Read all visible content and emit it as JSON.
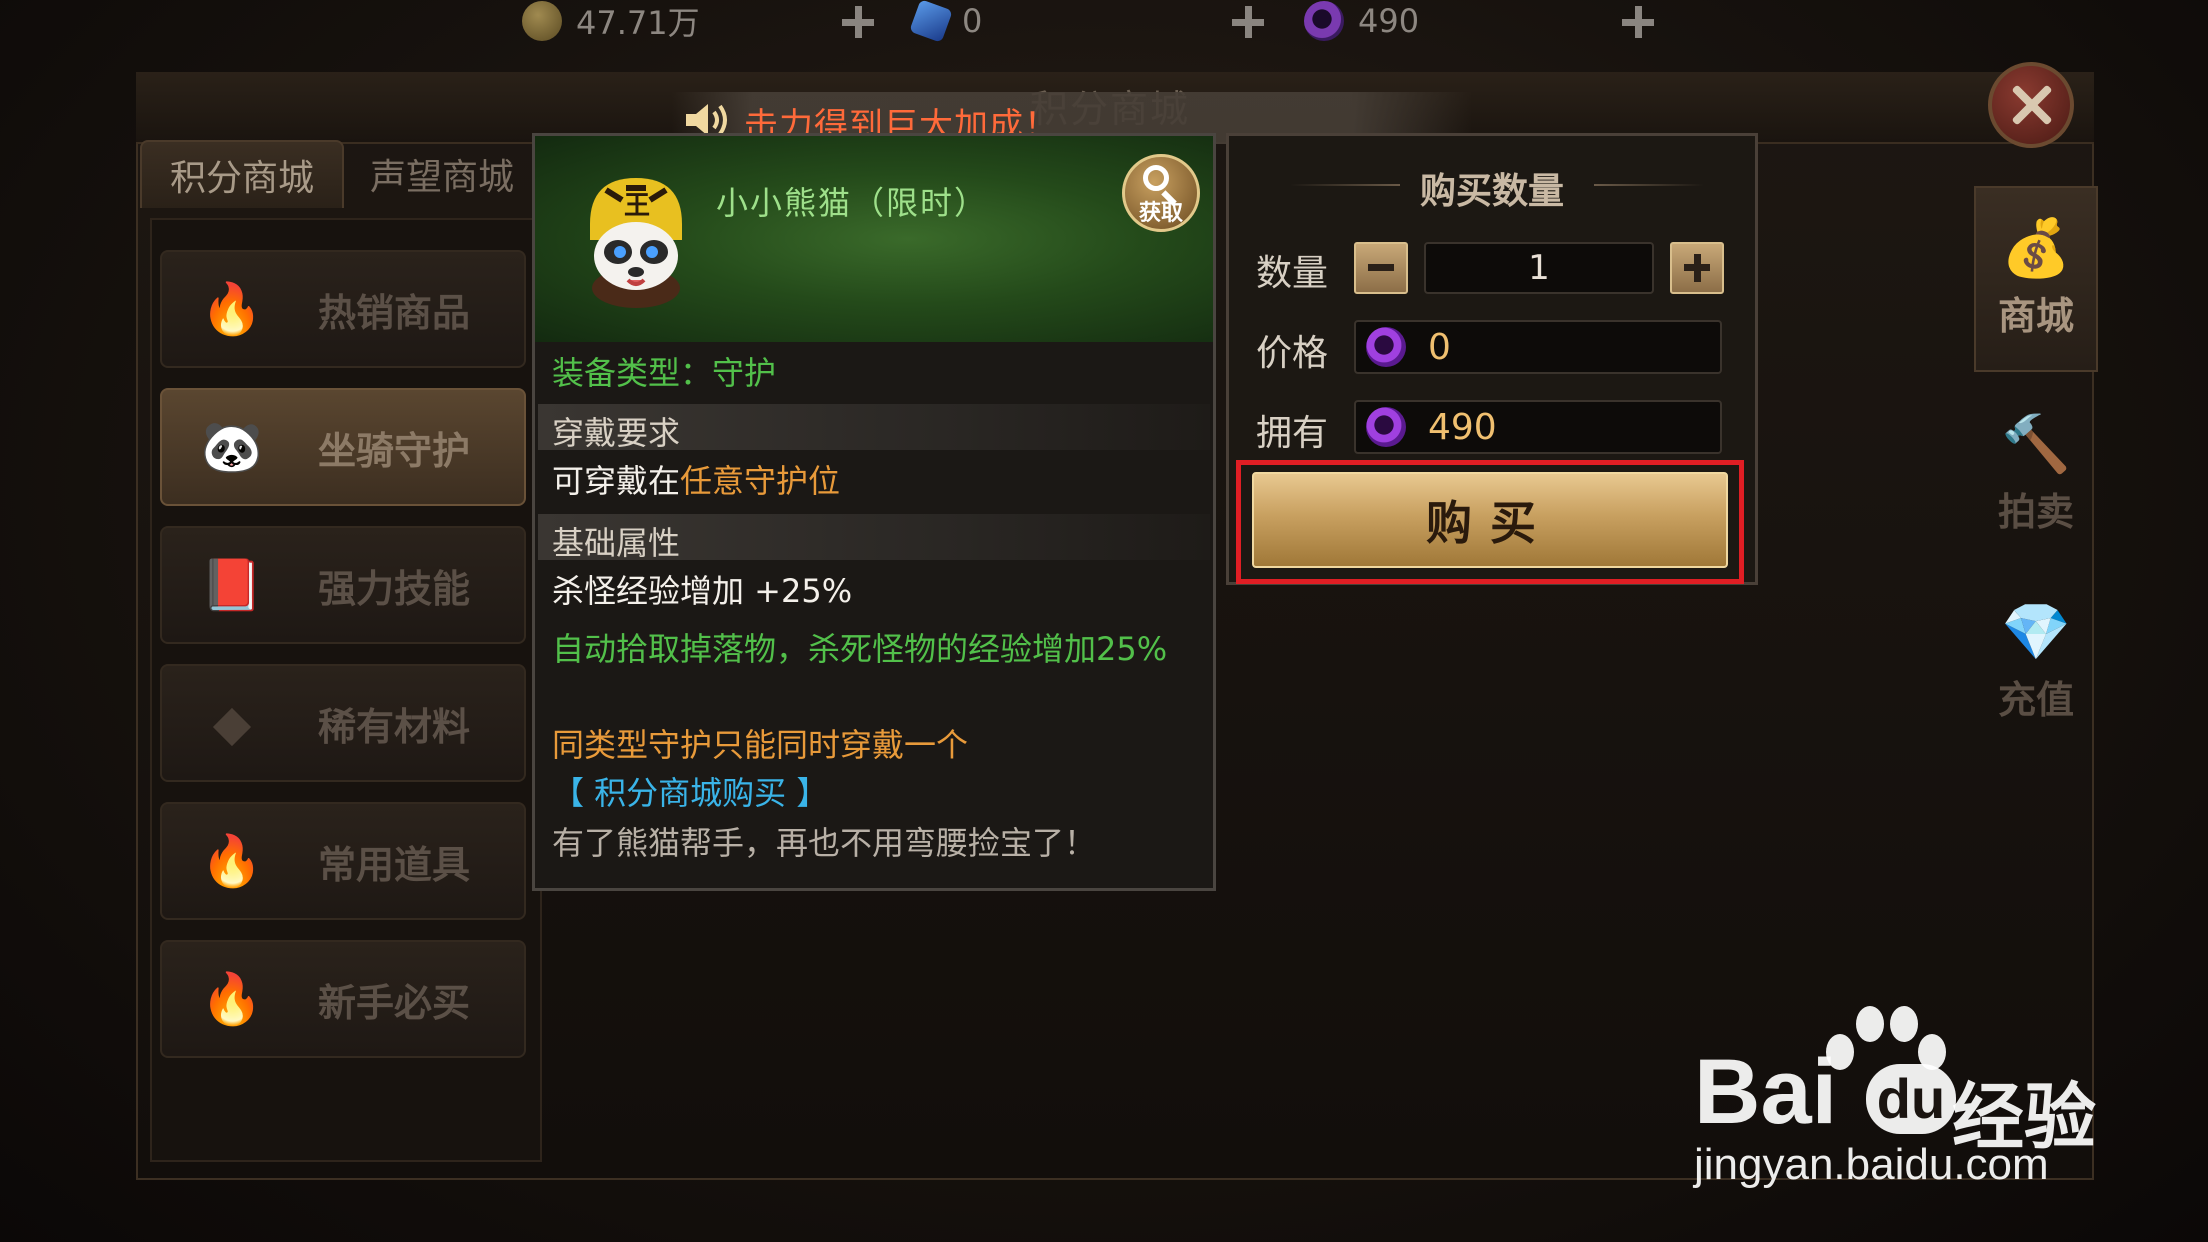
{
  "currencies": [
    {
      "name": "gold",
      "value": "47.71万",
      "color": "#c8a040"
    },
    {
      "name": "diamond",
      "value": "0",
      "color": "#3a7ad8"
    },
    {
      "name": "points",
      "value": "490",
      "color": "#8a3ad0"
    }
  ],
  "window": {
    "title": "积分商城"
  },
  "tabs": [
    {
      "label": "积分商城",
      "active": true
    },
    {
      "label": "声望商城",
      "active": false
    }
  ],
  "categories": [
    {
      "label": "热销商品",
      "icon": "flame-icon"
    },
    {
      "label": "坐骑守护",
      "icon": "panda-icon",
      "active": true
    },
    {
      "label": "强力技能",
      "icon": "book-icon"
    },
    {
      "label": "稀有材料",
      "icon": "crystal-icon"
    },
    {
      "label": "常用道具",
      "icon": "flame-icon"
    },
    {
      "label": "新手必买",
      "icon": "flame-icon"
    }
  ],
  "right_nav": [
    {
      "label": "商城",
      "icon": "money-bag-icon",
      "active": true
    },
    {
      "label": "拍卖",
      "icon": "gavel-icon"
    },
    {
      "label": "充值",
      "icon": "diamond-icon"
    }
  ],
  "notice": {
    "text": "击力得到巨大加成！"
  },
  "item": {
    "name": "小小熊猫（限时）",
    "get_label": "获取",
    "equip_type": "装备类型：守护",
    "req_header": "穿戴要求",
    "req_prefix": "可穿戴在",
    "req_highlight": "任意守护位",
    "attr_header": "基础属性",
    "attr_line": "杀怪经验增加 +25%",
    "effect": "自动拾取掉落物，杀死怪物的经验增加25%",
    "restriction": "同类型守护只能同时穿戴一个",
    "source": "【 积分商城购买 】",
    "flavor": "有了熊猫帮手，再也不用弯腰捡宝了！"
  },
  "purchase": {
    "title": "购买数量",
    "qty_label": "数量",
    "qty_value": "1",
    "price_label": "价格",
    "price_value": "0",
    "owned_label": "拥有",
    "owned_value": "490",
    "buy_label": "购买"
  },
  "watermark": {
    "brand": "Bai",
    "suffix": "经验",
    "url": "jingyan.baidu.com"
  }
}
